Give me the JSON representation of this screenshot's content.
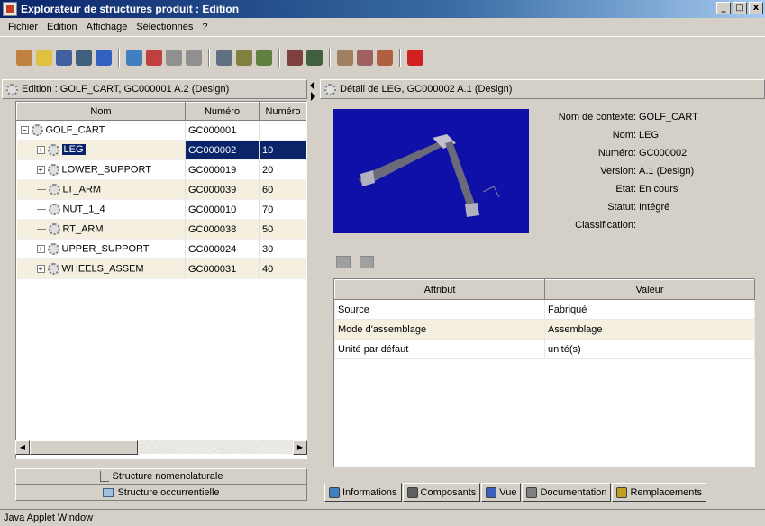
{
  "window": {
    "title": "Explorateur de structures produit : Edition",
    "minimize": "_",
    "restore": "□",
    "close": "x"
  },
  "menu": [
    "Fichier",
    "Edition",
    "Affichage",
    "Sélectionnés",
    "?"
  ],
  "toolbar": {
    "icons": [
      {
        "name": "new-part-icon",
        "color": "#c08040"
      },
      {
        "name": "open-folder-icon",
        "color": "#e0c040"
      },
      {
        "name": "window-icon",
        "color": "#4060a0"
      },
      {
        "name": "structure-icon",
        "color": "#406080"
      },
      {
        "name": "refresh-icon",
        "color": "#3060c0"
      },
      {
        "name": "sep"
      },
      {
        "name": "info-icon",
        "color": "#4080c0"
      },
      {
        "name": "insert-icon",
        "color": "#c04040"
      },
      {
        "name": "move-up-icon",
        "color": "#909090"
      },
      {
        "name": "move-down-icon",
        "color": "#909090"
      },
      {
        "name": "sep"
      },
      {
        "name": "list-icon",
        "color": "#607080"
      },
      {
        "name": "explode-icon",
        "color": "#808040"
      },
      {
        "name": "replace-icon",
        "color": "#608040"
      },
      {
        "name": "sep"
      },
      {
        "name": "link-icon",
        "color": "#804040"
      },
      {
        "name": "tree-icon",
        "color": "#406040"
      },
      {
        "name": "sep"
      },
      {
        "name": "edit-icon",
        "color": "#a08060"
      },
      {
        "name": "edit-check-icon",
        "color": "#a06060"
      },
      {
        "name": "edit-mark-icon",
        "color": "#b06040"
      },
      {
        "name": "sep"
      },
      {
        "name": "help-icon",
        "color": "#d02020"
      }
    ]
  },
  "left": {
    "header": "Edition : GOLF_CART, GC000001 A.2 (Design)",
    "columns": [
      "Nom",
      "Numéro",
      "Numéro"
    ],
    "rows": [
      {
        "name": "GOLF_CART",
        "number": "GC000001",
        "line": "",
        "expander": "−",
        "indent": 0,
        "alt": false,
        "selected": false
      },
      {
        "name": "LEG",
        "number": "GC000002",
        "line": "10",
        "expander": "+",
        "indent": 1,
        "alt": true,
        "selected": true
      },
      {
        "name": "LOWER_SUPPORT",
        "number": "GC000019",
        "line": "20",
        "expander": "+",
        "indent": 1,
        "alt": false,
        "selected": false
      },
      {
        "name": "LT_ARM",
        "number": "GC000039",
        "line": "60",
        "expander": "",
        "indent": 1,
        "alt": true,
        "selected": false
      },
      {
        "name": "NUT_1_4",
        "number": "GC000010",
        "line": "70",
        "expander": "",
        "indent": 1,
        "alt": false,
        "selected": false
      },
      {
        "name": "RT_ARM",
        "number": "GC000038",
        "line": "50",
        "expander": "",
        "indent": 1,
        "alt": true,
        "selected": false
      },
      {
        "name": "UPPER_SUPPORT",
        "number": "GC000024",
        "line": "30",
        "expander": "+",
        "indent": 1,
        "alt": false,
        "selected": false
      },
      {
        "name": "WHEELS_ASSEM",
        "number": "GC000031",
        "line": "40",
        "expander": "+",
        "indent": 1,
        "alt": true,
        "selected": false
      }
    ],
    "btn_nomenclature": "Structure nomenclaturale",
    "btn_occurrence": "Structure occurrentielle"
  },
  "right": {
    "header": "Détail de LEG, GC000002 A.1 (Design)",
    "props": [
      {
        "k": "Nom de contexte:",
        "v": "GOLF_CART"
      },
      {
        "k": "Nom:",
        "v": "LEG"
      },
      {
        "k": "Numéro:",
        "v": "GC000002"
      },
      {
        "k": "Version:",
        "v": "A.1 (Design)"
      },
      {
        "k": "Etat:",
        "v": "En cours"
      },
      {
        "k": "Statut:",
        "v": "Intégré"
      },
      {
        "k": "Classification:",
        "v": ""
      }
    ],
    "attr_columns": [
      "Attribut",
      "Valeur"
    ],
    "attrs": [
      {
        "k": "Source",
        "v": "Fabriqué"
      },
      {
        "k": "Mode d'assemblage",
        "v": "Assemblage"
      },
      {
        "k": "Unité par défaut",
        "v": "unité(s)"
      }
    ],
    "tabs": [
      {
        "label": "Informations",
        "icon": "info-icon",
        "color": "#4080c0",
        "active": true
      },
      {
        "label": "Composants",
        "icon": "components-icon",
        "color": "#606060",
        "active": false
      },
      {
        "label": "Vue",
        "icon": "view-icon",
        "color": "#4060c0",
        "active": false
      },
      {
        "label": "Documentation",
        "icon": "document-icon",
        "color": "#808080",
        "active": false
      },
      {
        "label": "Remplacements",
        "icon": "replacements-icon",
        "color": "#c0a020",
        "active": false
      }
    ]
  },
  "status": "Java Applet Window"
}
